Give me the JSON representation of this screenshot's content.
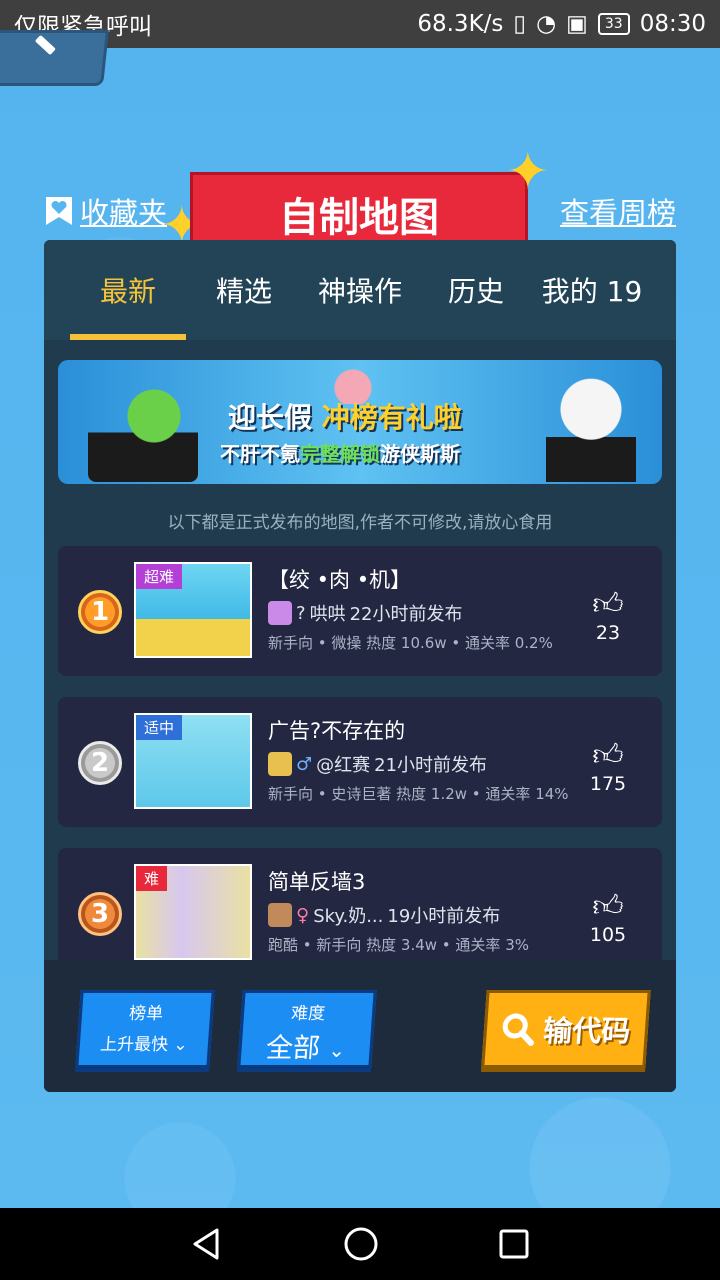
{
  "status_bar": {
    "carrier": "仅限紧急呼叫",
    "speed": "68.3K/s",
    "battery": "33",
    "time": "08:30"
  },
  "header": {
    "favorites_label": "收藏夹",
    "title": "自制地图",
    "weekly_label": "查看周榜"
  },
  "tabs": [
    {
      "label": "最新",
      "active": true
    },
    {
      "label": "精选",
      "active": false
    },
    {
      "label": "神操作",
      "active": false
    },
    {
      "label": "历史",
      "active": false
    },
    {
      "label": "我的 19",
      "active": false
    }
  ],
  "promo": {
    "line1_a": "迎长假",
    "line1_b": "冲榜有礼啦",
    "line2_a": "不肝不氪",
    "line2_b": "完整解锁",
    "line2_c": "游侠斯斯"
  },
  "notice": "以下都是正式发布的地图,作者不可修改,请放心食用",
  "maps": [
    {
      "rank": "1",
      "difficulty": "超难",
      "difficulty_color": "#b43fd6",
      "title": "【绞 •肉 •机】",
      "author_prefix": "?",
      "author": "哄哄",
      "posted": "22小时前发布",
      "stats": "新手向 • 微操 热度 10.6w • 通关率 0.2%",
      "likes": "23"
    },
    {
      "rank": "2",
      "difficulty": "适中",
      "difficulty_color": "#2f6fd8",
      "title": "广告?不存在的",
      "author_prefix": "♂",
      "author": "@红赛",
      "posted": "21小时前发布",
      "stats": "新手向 • 史诗巨著 热度 1.2w • 通关率 14%",
      "likes": "175"
    },
    {
      "rank": "3",
      "difficulty": "难",
      "difficulty_color": "#e8283b",
      "title": "简单反墙3",
      "author_prefix": "♀",
      "author": "Sky.奶...",
      "posted": "19小时前发布",
      "stats": "跑酷 • 新手向 热度 3.4w • 通关率 3%",
      "likes": "105"
    }
  ],
  "bottom_bar": {
    "rank_label": "榜单",
    "rank_value": "上升最快",
    "difficulty_label": "难度",
    "difficulty_value": "全部",
    "code_button": "输代码"
  },
  "colors": {
    "background": "#58b6ef",
    "panel": "#1f3b4d",
    "accent": "#f4c33a",
    "title_red": "#e8283b"
  }
}
